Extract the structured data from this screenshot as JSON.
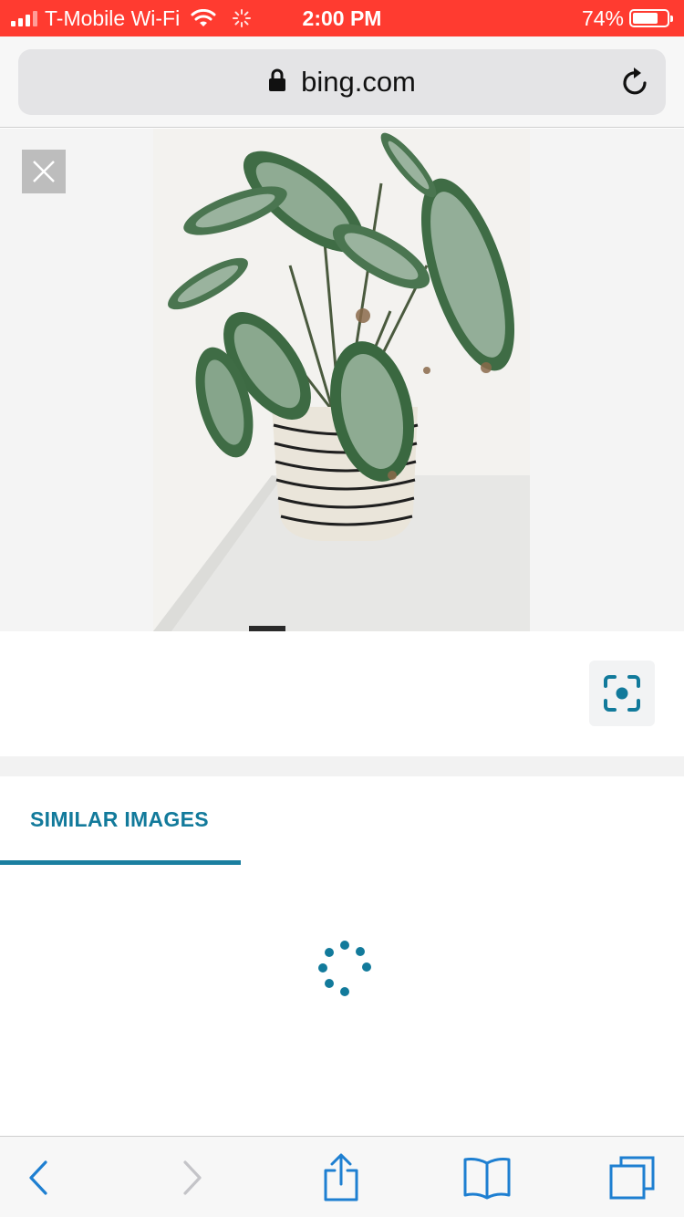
{
  "status_bar": {
    "carrier": "T-Mobile Wi-Fi",
    "time": "2:00 PM",
    "battery_percent": "74%",
    "battery_level": 0.74,
    "background_color": "#ff3b30"
  },
  "browser": {
    "url": "bing.com",
    "icons": {
      "lock": "lock-icon",
      "reload": "reload-icon"
    }
  },
  "viewer": {
    "image_subject": "potted-plant-photo",
    "close_icon": "close-icon",
    "visual_search_icon": "visual-search-icon"
  },
  "tabs": [
    {
      "label": "SIMILAR IMAGES",
      "active": true
    }
  ],
  "results": {
    "state": "loading"
  },
  "toolbar": {
    "icons": [
      "back-icon",
      "forward-icon",
      "share-icon",
      "bookmarks-icon",
      "tabs-icon"
    ]
  },
  "colors": {
    "accent": "#127a9b",
    "status_bar": "#ff3b30",
    "toolbar_icon": "#1e7fd1"
  }
}
